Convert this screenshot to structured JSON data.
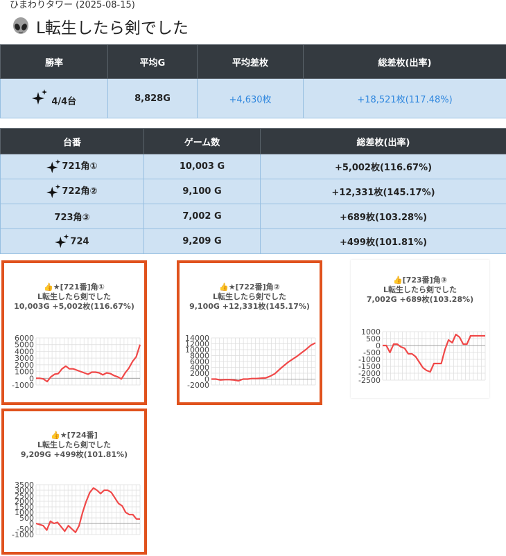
{
  "header": {
    "subtitle": "ひまわりタワー (2025-08-15)",
    "title": "L転生したら剣でした",
    "icon": "alien-icon"
  },
  "summary": {
    "columns": [
      "勝率",
      "平均G",
      "平均差枚",
      "総差枚(出率)"
    ],
    "row": {
      "win_rate": "4/4台",
      "avg_games": "8,828G",
      "avg_diff": "+4,630枚",
      "total_diff": "+18,521枚(117.48%)"
    }
  },
  "machines": {
    "columns": [
      "台番",
      "ゲーム数",
      "総差枚(出率)"
    ],
    "rows": [
      {
        "number": "721角①",
        "games": "10,003 G",
        "diff": "+5,002枚(116.67%)",
        "sparkle": true
      },
      {
        "number": "722角②",
        "games": "9,100 G",
        "diff": "+12,331枚(145.17%)",
        "sparkle": true
      },
      {
        "number": "723角③",
        "games": "7,002 G",
        "diff": "+689枚(103.28%)",
        "sparkle": false
      },
      {
        "number": "724",
        "games": "9,209 G",
        "diff": "+499枚(101.81%)",
        "sparkle": true
      }
    ]
  },
  "cards": [
    {
      "line1": "👍★[721番]角①",
      "line2": "L転生したら剣でした",
      "line3": "10,003G +5,002枚(116.67%)",
      "highlighted": true
    },
    {
      "line1": "👍★[722番]角②",
      "line2": "L転生したら剣でした",
      "line3": "9,100G +12,331枚(145.17%)",
      "highlighted": true
    },
    {
      "line1": "👍[723番]角③",
      "line2": "L転生したら剣でした",
      "line3": "7,002G +689枚(103.28%)",
      "highlighted": false
    },
    {
      "line1": "👍★[724番]",
      "line2": "L転生したら剣でした",
      "line3": "9,209G +499枚(101.81%)",
      "highlighted": true
    }
  ],
  "chart_data": [
    {
      "type": "line",
      "ylim": [
        -1000,
        6000
      ],
      "yticks": [
        6000,
        5000,
        4000,
        3000,
        2000,
        1000,
        0,
        -1000
      ],
      "line_color": "#f04848",
      "values": [
        0,
        0,
        -100,
        -500,
        200,
        600,
        700,
        1400,
        1800,
        1400,
        1400,
        1200,
        1000,
        800,
        600,
        900,
        900,
        800,
        500,
        800,
        700,
        400,
        200,
        -100,
        800,
        1500,
        2500,
        3200,
        5000
      ]
    },
    {
      "type": "line",
      "ylim": [
        -2000,
        14000
      ],
      "yticks": [
        14000,
        12000,
        10000,
        8000,
        6000,
        4000,
        2000,
        0,
        -2000
      ],
      "line_color": "#f04848",
      "values": [
        0,
        0,
        -300,
        -200,
        -200,
        -300,
        -600,
        0,
        0,
        200,
        200,
        300,
        400,
        1000,
        1800,
        3200,
        4500,
        5800,
        6800,
        7800,
        9000,
        10200,
        11500,
        12300
      ]
    },
    {
      "type": "line",
      "ylim": [
        -2500,
        1000
      ],
      "yticks": [
        1000,
        500,
        0,
        -500,
        -1000,
        -1500,
        -2000,
        -2500
      ],
      "line_color": "#f04848",
      "values": [
        0,
        0,
        -500,
        100,
        100,
        -100,
        -200,
        -600,
        -600,
        -800,
        -1200,
        -1600,
        -1800,
        -1900,
        -1300,
        -1300,
        -1300,
        -300,
        400,
        200,
        800,
        600,
        100,
        100,
        700,
        700,
        700,
        700,
        700
      ]
    },
    {
      "type": "line",
      "ylim": [
        -1000,
        3500
      ],
      "yticks": [
        3500,
        3000,
        2500,
        2000,
        1500,
        1000,
        500,
        0,
        -500,
        -1000
      ],
      "line_color": "#f04848",
      "values": [
        0,
        -100,
        -200,
        -600,
        200,
        0,
        100,
        -300,
        -700,
        -200,
        -500,
        -800,
        -200,
        1000,
        2000,
        2800,
        3200,
        3000,
        2700,
        3000,
        3000,
        2800,
        2300,
        1800,
        1600,
        1000,
        800,
        800,
        400,
        400
      ]
    }
  ]
}
